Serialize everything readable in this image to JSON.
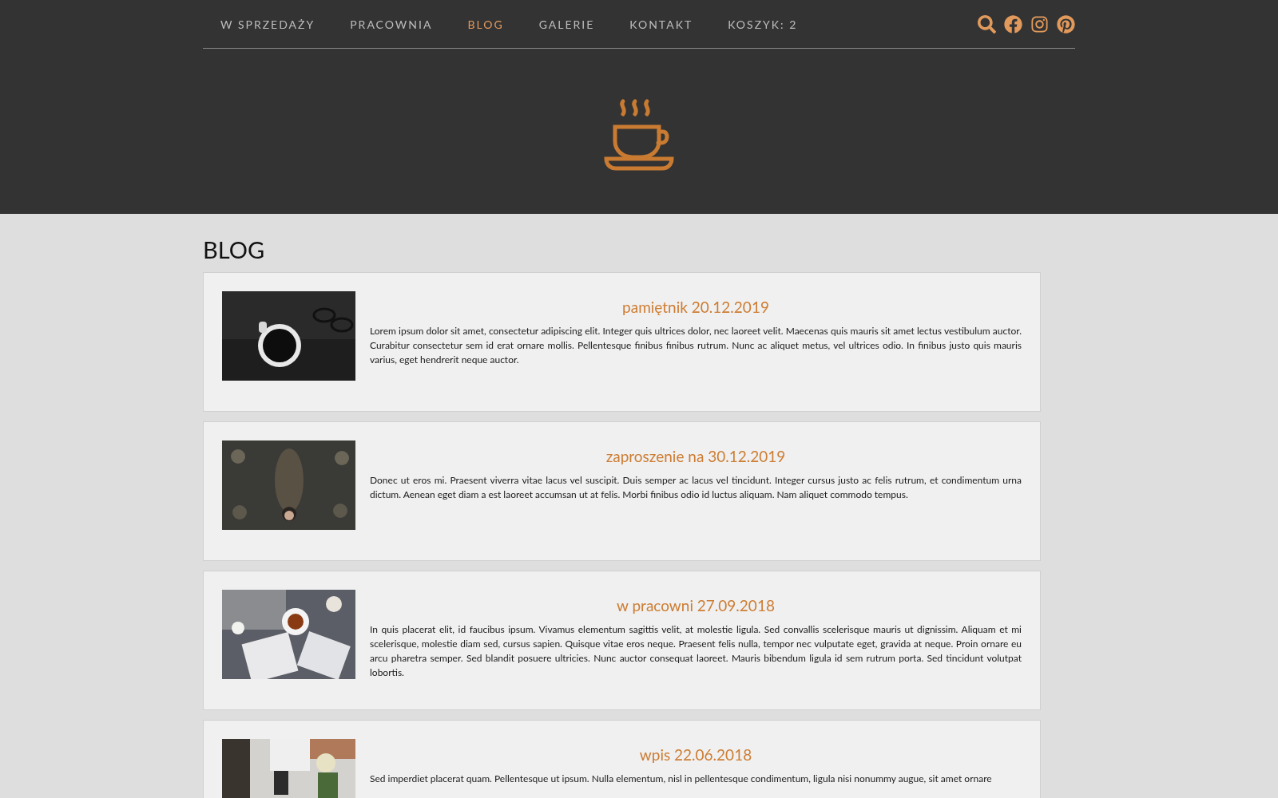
{
  "nav": {
    "items": [
      {
        "label": "W SPRZEDAŻY",
        "selected": false
      },
      {
        "label": "PRACOWNIA",
        "selected": false
      },
      {
        "label": "BLOG",
        "selected": true
      },
      {
        "label": "GALERIE",
        "selected": false
      },
      {
        "label": "KONTAKT",
        "selected": false
      },
      {
        "label": "KOSZYK: 2",
        "selected": false
      }
    ]
  },
  "page": {
    "title": "BLOG"
  },
  "posts": [
    {
      "title": "pamiętnik 20.12.2019",
      "text": "Lorem ipsum dolor sit amet, consectetur adipiscing elit. Integer quis ultrices dolor, nec laoreet velit. Maecenas quis mauris sit amet lectus vestibulum auctor. Curabitur consectetur sem id erat ornare mollis. Pellentesque finibus finibus rutrum. Nunc ac aliquet metus, vel ultrices odio. In finibus justo quis mauris varius, eget hendrerit neque auctor."
    },
    {
      "title": "zaproszenie na 30.12.2019",
      "text": "Donec ut eros mi. Praesent viverra vitae lacus vel suscipit. Duis semper ac lacus vel tincidunt. Integer cursus justo ac felis rutrum, et condimentum urna dictum. Aenean eget diam a est laoreet accumsan ut at felis. Morbi finibus odio id luctus aliquam. Nam aliquet commodo tempus."
    },
    {
      "title": "w pracowni 27.09.2018",
      "text": "In quis placerat elit, id faucibus ipsum. Vivamus elementum sagittis velit, at molestie ligula. Sed convallis scelerisque mauris ut dignissim. Aliquam et mi scelerisque, molestie diam sed, cursus sapien. Quisque vitae eros neque. Praesent felis nulla, tempor nec vulputate eget, gravida at neque. Proin ornare eu arcu pharetra semper. Sed blandit posuere ultricies. Nunc auctor consequat laoreet. Mauris bibendum ligula id sem rutrum porta. Sed tincidunt volutpat lobortis."
    },
    {
      "title": "wpis 22.06.2018",
      "text": "Sed imperdiet placerat quam. Pellentesque ut ipsum. Nulla elementum, nisl in pellentesque condimentum, ligula nisi nonummy augue, sit amet ornare"
    }
  ]
}
